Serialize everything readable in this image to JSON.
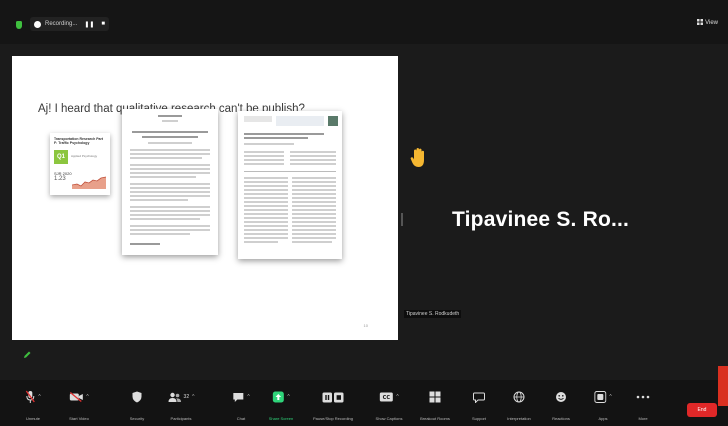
{
  "top_bar": {
    "recording_label": "Recording...",
    "pause_glyph": "❚❚",
    "stop_glyph": "■",
    "view_label": "View",
    "view_icon": "view-grid-icon"
  },
  "slide": {
    "title": "Aj! I heard that qualitative research can't be publish?",
    "journal_card": {
      "name": "Transportation Research Part F: Traffic Psychology",
      "quartile": "Q1",
      "subject": "Applied Psychology",
      "score_label": "SJR 2020",
      "score_value": "1.23"
    },
    "page_number": "10"
  },
  "speaker": {
    "name": "Tipavinee S. Ro...",
    "tile_name": "Tipavinee S. Rodkudeth",
    "reaction_icon": "raised-hand-icon"
  },
  "toolbar": {
    "items": [
      {
        "label": "Unmute",
        "icon": "microphone-muted-icon"
      },
      {
        "label": "Start Video",
        "icon": "video-off-icon"
      },
      {
        "label": "Security",
        "icon": "shield-icon"
      },
      {
        "label": "Participants",
        "icon": "participants-icon",
        "count": "32"
      },
      {
        "label": "Chat",
        "icon": "chat-icon"
      },
      {
        "label": "Share Screen",
        "icon": "share-screen-icon"
      },
      {
        "label": "Pause/Stop Recording",
        "icon": "pause-stop-icon"
      },
      {
        "label": "Show Captions",
        "icon": "captions-icon"
      },
      {
        "label": "Breakout Rooms",
        "icon": "breakout-rooms-icon"
      },
      {
        "label": "Support",
        "icon": "support-icon"
      },
      {
        "label": "Interpretation",
        "icon": "globe-icon"
      },
      {
        "label": "Reactions",
        "icon": "reactions-icon"
      },
      {
        "label": "Apps",
        "icon": "apps-icon"
      },
      {
        "label": "More",
        "icon": "more-dots-icon"
      }
    ],
    "end_label": "End"
  },
  "colors": {
    "background": "#1a1a1a",
    "share_green": "#2fd57a",
    "end_red": "#e02828",
    "quartile_green": "#8cc63f"
  }
}
